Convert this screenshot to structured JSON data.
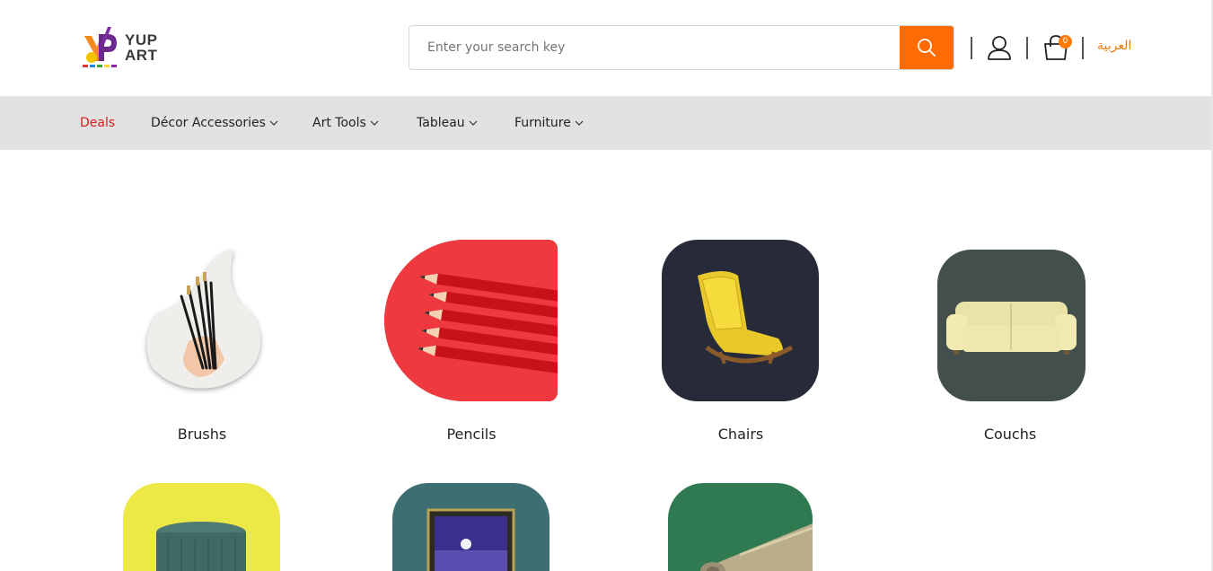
{
  "header": {
    "logo_text_line1": "YUP",
    "logo_text_line2": "ART",
    "search": {
      "placeholder": "Enter your search key"
    },
    "cart_count": "0",
    "language_link": "العربية"
  },
  "nav": {
    "items": [
      {
        "label": "Deals"
      },
      {
        "label": "Décor Accessories"
      },
      {
        "label": "Art Tools"
      },
      {
        "label": "Tableau"
      },
      {
        "label": "Furniture"
      }
    ]
  },
  "categories": [
    {
      "label": "Brushs",
      "bg": "#ffffff"
    },
    {
      "label": "Pencils",
      "bg": "#e8313a"
    },
    {
      "label": "Chairs",
      "bg": "#262a39"
    },
    {
      "label": "Couchs",
      "bg": "#434f4c"
    },
    {
      "label": "",
      "bg": "#ece846"
    },
    {
      "label": "",
      "bg": "#3d6e72"
    },
    {
      "label": "",
      "bg": "#2f7a50"
    }
  ],
  "colors": {
    "accent": "#ff6b00",
    "deals": "#dc1d1d",
    "nav_bg": "#e2e2e2"
  }
}
